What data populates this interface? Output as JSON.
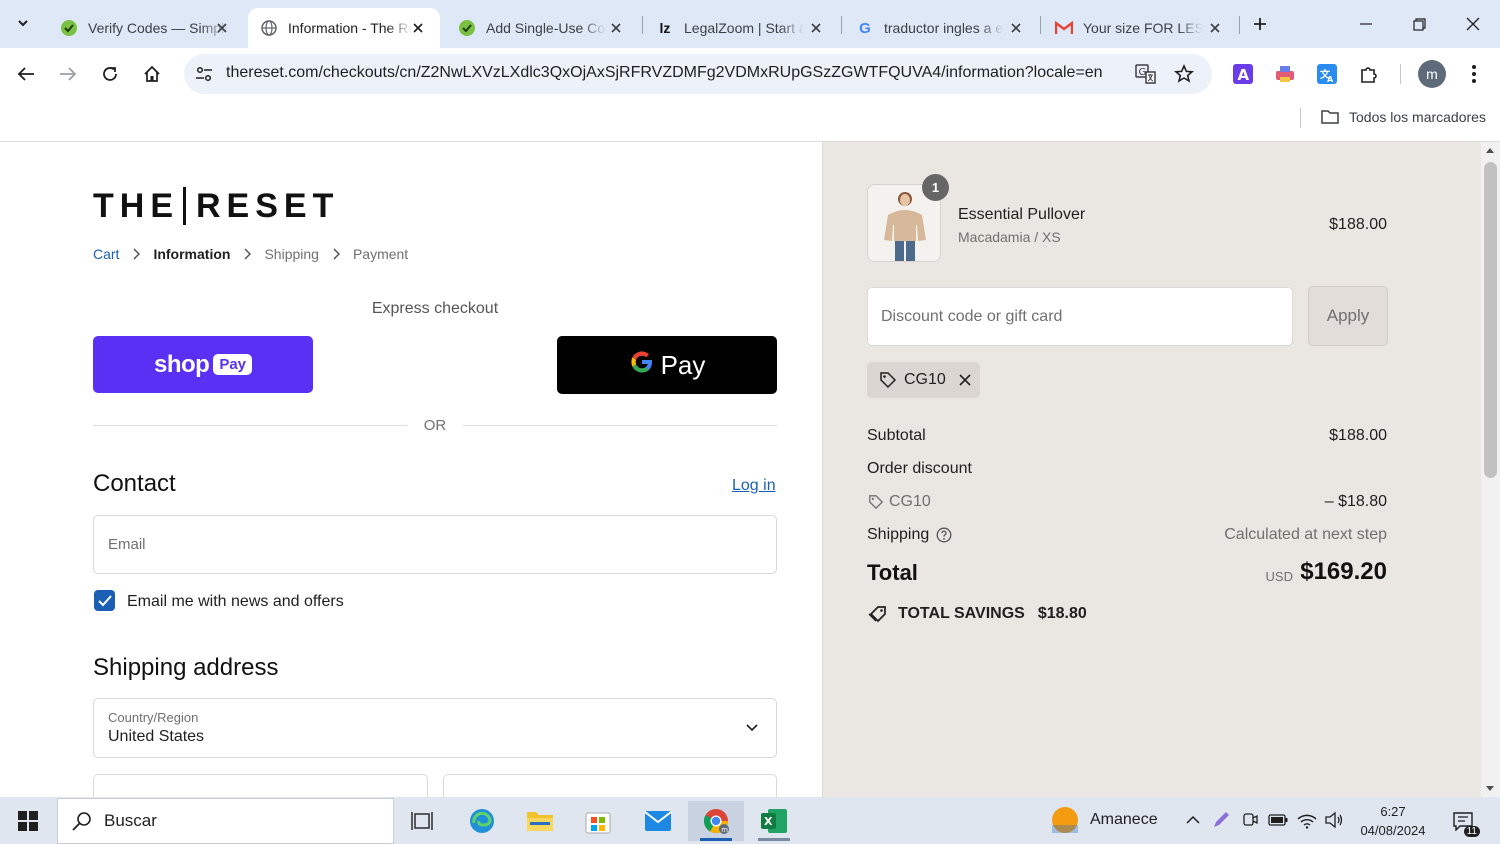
{
  "browser": {
    "tabs": [
      {
        "title": "Verify Codes — SimpleLogin",
        "icon": "simplelogin-icon",
        "active": false
      },
      {
        "title": "Information - The Reset",
        "icon": "globe-icon",
        "active": true
      },
      {
        "title": "Add Single-Use Code",
        "icon": "simplelogin-icon",
        "active": false
      },
      {
        "title": "LegalZoom | Start a Business",
        "icon": "legalzoom-icon",
        "active": false
      },
      {
        "title": "traductor ingles a español",
        "icon": "google-icon",
        "active": false
      },
      {
        "title": "Your size FOR LESS",
        "icon": "gmail-icon",
        "active": false
      }
    ],
    "url": "thereset.com/checkouts/cn/Z2NwLXVzLXdlc3QxOjAxSjRFRVZDMFg2VDMxRUpGSzZGWTFQUVA4/information?locale=en",
    "profile_initial": "m",
    "bookmarks_label": "Todos los marcadores"
  },
  "checkout": {
    "logo_left": "THE",
    "logo_right": "RESET",
    "breadcrumb": {
      "cart": "Cart",
      "information": "Information",
      "shipping": "Shipping",
      "payment": "Payment"
    },
    "express_label": "Express checkout",
    "shoppay_shop": "shop",
    "shoppay_pay": "Pay",
    "gpay_pay": "Pay",
    "or_label": "OR",
    "contact_heading": "Contact",
    "login_label": "Log in",
    "email_placeholder": "Email",
    "newsletter_label": "Email me with news and offers",
    "newsletter_checked": true,
    "shipping_heading": "Shipping address",
    "country_label": "Country/Region",
    "country_value": "United States"
  },
  "summary": {
    "product": {
      "name": "Essential Pullover",
      "variant": "Macadamia / XS",
      "price": "$188.00",
      "quantity": "1"
    },
    "discount_placeholder": "Discount code or gift card",
    "apply_label": "Apply",
    "applied_code": "CG10",
    "subtotal_label": "Subtotal",
    "subtotal_value": "$188.00",
    "order_discount_label": "Order discount",
    "discount_code": "CG10",
    "discount_value": "– $18.80",
    "shipping_label": "Shipping",
    "shipping_value": "Calculated at next step",
    "total_label": "Total",
    "currency": "USD",
    "total_value": "$169.20",
    "savings_label": "TOTAL SAVINGS",
    "savings_value": "$18.80"
  },
  "taskbar": {
    "search_placeholder": "Buscar",
    "weather": "Amanece",
    "time": "6:27",
    "date": "04/08/2024",
    "notification_count": "11"
  },
  "colors": {
    "accent": "#1a5fb4",
    "shoppay": "#5a31f4",
    "summary_bg": "#eae6e2"
  }
}
